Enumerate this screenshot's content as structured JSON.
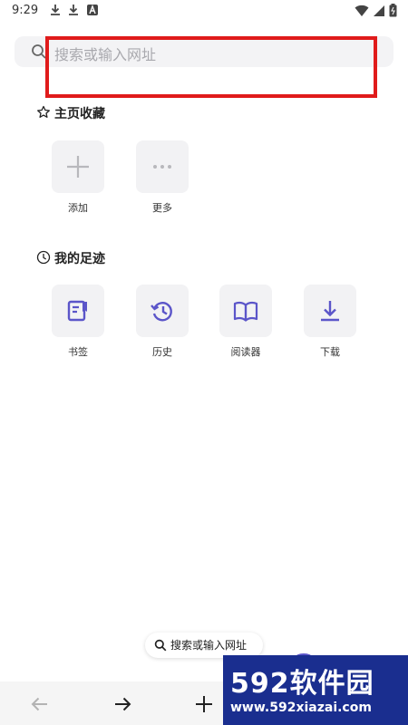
{
  "status_bar": {
    "time": "9:29"
  },
  "search": {
    "placeholder": "搜索或输入网址"
  },
  "favorites": {
    "title": "主页收藏",
    "tiles": [
      {
        "label": "添加",
        "icon": "plus-icon"
      },
      {
        "label": "更多",
        "icon": "more-dots-icon"
      }
    ]
  },
  "history_section": {
    "title": "我的足迹",
    "tiles": [
      {
        "label": "书签",
        "icon": "bookmark-icon"
      },
      {
        "label": "历史",
        "icon": "history-icon"
      },
      {
        "label": "阅读器",
        "icon": "reader-book-icon"
      },
      {
        "label": "下载",
        "icon": "download-icon"
      }
    ]
  },
  "floating_search": {
    "label": "搜索或输入网址"
  },
  "watermark": {
    "brand": "592软件园",
    "url": "www.592xiazai.com"
  },
  "colors": {
    "accent": "#5b55c9",
    "highlight": "#e01b1b",
    "tile_bg": "#f2f2f4"
  }
}
